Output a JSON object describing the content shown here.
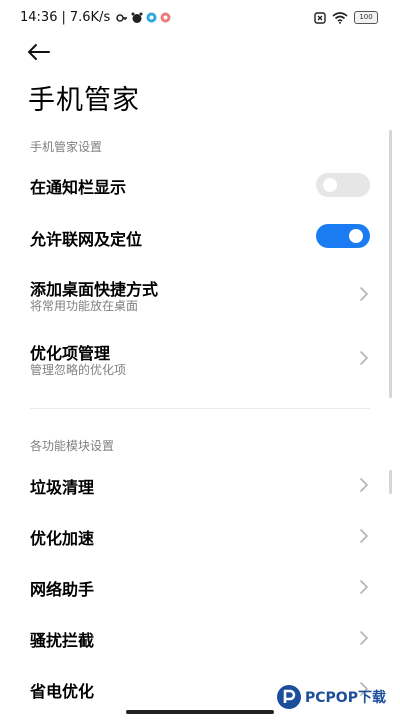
{
  "status_bar": {
    "time": "14:36",
    "separator": "|",
    "net_speed": "7.6K/s",
    "battery": "100"
  },
  "header": {
    "title": "手机管家"
  },
  "sections": [
    {
      "header": "手机管家设置",
      "items": [
        {
          "title": "在通知栏显示",
          "type": "toggle",
          "on": false
        },
        {
          "title": "允许联网及定位",
          "type": "toggle",
          "on": true
        },
        {
          "title": "添加桌面快捷方式",
          "subtitle": "将常用功能放在桌面",
          "type": "link"
        },
        {
          "title": "优化项管理",
          "subtitle": "管理忽略的优化项",
          "type": "link"
        }
      ]
    },
    {
      "header": "各功能模块设置",
      "items": [
        {
          "title": "垃圾清理",
          "type": "link"
        },
        {
          "title": "优化加速",
          "type": "link"
        },
        {
          "title": "网络助手",
          "type": "link"
        },
        {
          "title": "骚扰拦截",
          "type": "link"
        },
        {
          "title": "省电优化",
          "type": "link"
        }
      ]
    }
  ],
  "watermark": {
    "text": "PCPOP下载"
  },
  "colors": {
    "accent": "#1a7cf0",
    "toggle_off": "#e6e6e6",
    "secondary_text": "#808080"
  }
}
